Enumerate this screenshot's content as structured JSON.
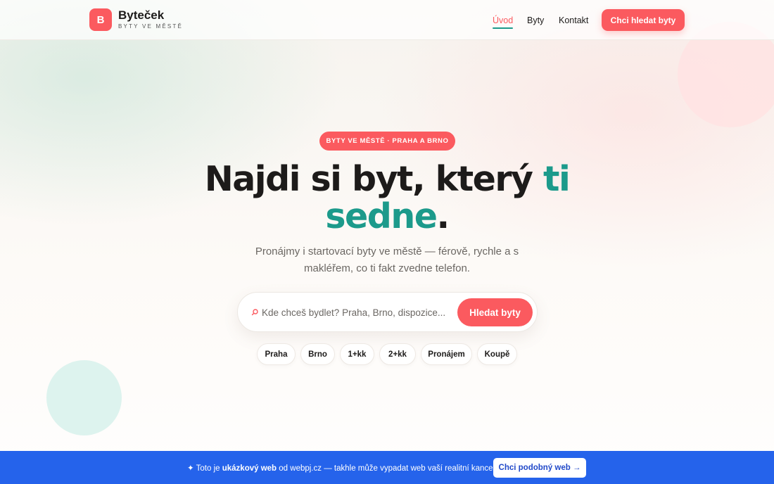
{
  "brand": {
    "logo_letter": "B",
    "name": "Byteček",
    "tagline": "BYTY VE MĚSTĚ"
  },
  "nav": {
    "items": [
      {
        "label": "Úvod",
        "active": true
      },
      {
        "label": "Byty",
        "active": false
      },
      {
        "label": "Kontakt",
        "active": false
      }
    ],
    "cta_label": "Chci hledat byty"
  },
  "hero": {
    "badge": "BYTY VE MĚSTĚ · PRAHA A BRNO",
    "headline_part1": "Najdi si byt, který ",
    "headline_accent1": "ti",
    "headline_accent2": "sedne",
    "headline_end": ".",
    "subtitle": "Pronájmy i startovací byty ve městě — férově, rychle a s makléřem, co ti fakt zvedne telefon."
  },
  "search": {
    "placeholder": "Kde chceš bydlet? Praha, Brno, dispozice...",
    "value": "",
    "button_label": "Hledat byty",
    "icon": "search-icon"
  },
  "chips": [
    "Praha",
    "Brno",
    "1+kk",
    "2+kk",
    "Pronájem",
    "Koupě"
  ],
  "promo": {
    "star": "✦",
    "text_prefix": "Toto je",
    "text_bold": "ukázkový web",
    "text_suffix": "od webpj.cz — takhle může vypadat web vaší realitní kanceláře.",
    "button_label": "Chci podobný web →"
  },
  "colors": {
    "accent": "#fb5a5f",
    "teal": "#1c9a8b",
    "promo_bar": "#2563eb"
  }
}
